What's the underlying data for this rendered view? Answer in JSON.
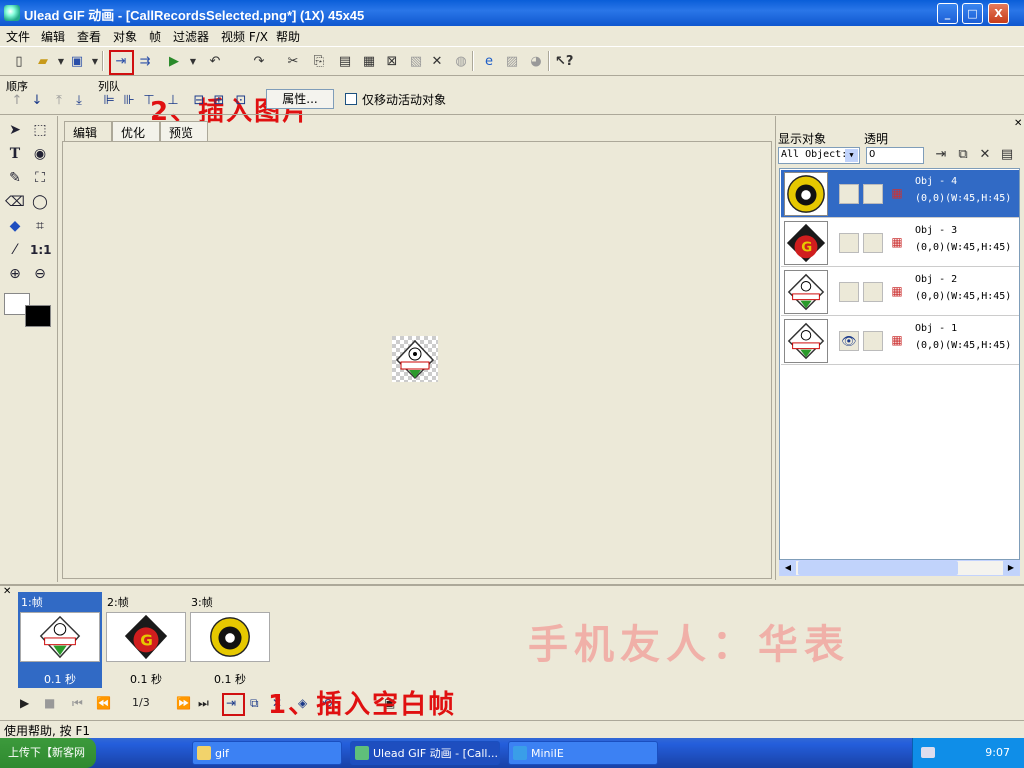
{
  "window": {
    "title": "Ulead GIF 动画 - [CallRecordsSelected.png*] (1X) 45x45",
    "minimize": "_",
    "maximize": "□",
    "close": "X"
  },
  "menu": [
    "文件",
    "编辑",
    "查看",
    "对象",
    "帧",
    "过滤器",
    "视频 F/X",
    "帮助"
  ],
  "toolbar": {
    "annotation_top": "2、插入图片",
    "order_label": "顺序",
    "queue_label": "列队",
    "properties_button": "属性...",
    "move_only_label": "仅移动活动对象"
  },
  "tabs": [
    "编辑",
    "优化",
    "预览"
  ],
  "object_panel": {
    "show_label": "显示对象",
    "opacity_label": "透明",
    "show_select": "All Object:",
    "opacity_value": "0",
    "objects": [
      {
        "name": "Obj - 4",
        "pos": "(0,0)(W:45,H:45)",
        "selected": true,
        "eye": ""
      },
      {
        "name": "Obj - 3",
        "pos": "(0,0)(W:45,H:45)",
        "selected": false,
        "eye": ""
      },
      {
        "name": "Obj - 2",
        "pos": "(0,0)(W:45,H:45)",
        "selected": false,
        "eye": ""
      },
      {
        "name": "Obj - 1",
        "pos": "(0,0)(W:45,H:45)",
        "selected": false,
        "eye": "👁"
      }
    ]
  },
  "frames": [
    {
      "label": "1:帧",
      "time": "0.1 秒",
      "selected": true
    },
    {
      "label": "2:帧",
      "time": "0.1 秒",
      "selected": false
    },
    {
      "label": "3:帧",
      "time": "0.1 秒",
      "selected": false
    }
  ],
  "playback": {
    "counter": "1/3"
  },
  "annotation_bottom": "1、插入空白帧",
  "watermark": "手机友人：华表",
  "status": "使用帮助, 按 F1",
  "taskbar": {
    "start": "上传下【新客网 WWW.XKER.COM】",
    "tasks": [
      "gif",
      "Ulead GIF 动画 - [Call...",
      "MiniIE"
    ],
    "clock": "9:07"
  },
  "colors": {
    "accent": "#316ac5",
    "annotation": "#e01010",
    "watermark": "#f0b0a8"
  }
}
